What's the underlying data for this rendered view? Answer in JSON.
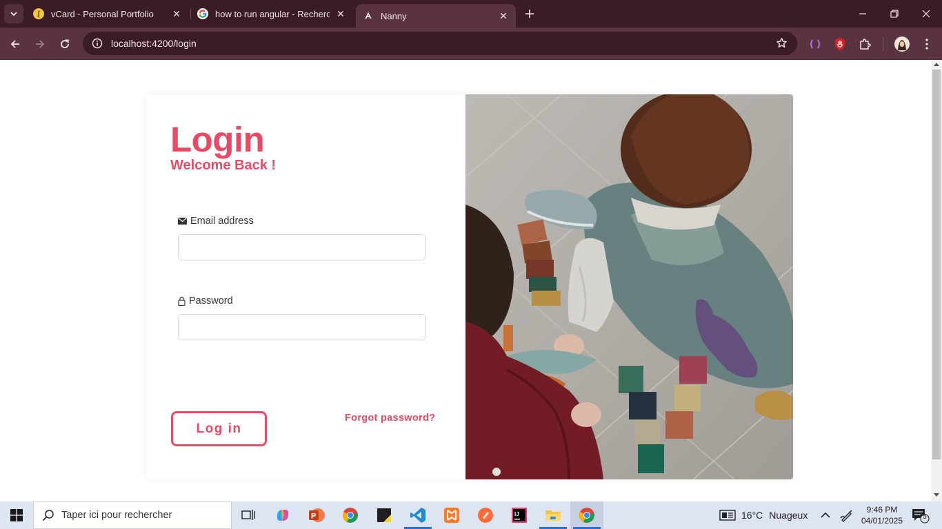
{
  "browser": {
    "tabs": [
      {
        "title": "vCard - Personal Portfolio",
        "favicon": "vcard-favicon"
      },
      {
        "title": "how to run angular - Recherche",
        "favicon": "google-favicon"
      },
      {
        "title": "Nanny",
        "favicon": "angular-favicon",
        "active": true
      }
    ],
    "url": "localhost:4200/login"
  },
  "login": {
    "title": "Login",
    "subtitle": "Welcome Back !",
    "email_label": "Email address",
    "email_value": "",
    "password_label": "Password",
    "password_value": "",
    "submit_label": "Log in",
    "forgot_label": "Forgot password?",
    "accent_color": "#e84a66"
  },
  "taskbar": {
    "search_placeholder": "Taper ici pour rechercher",
    "weather_temp": "16°C",
    "weather_desc": "Nuageux",
    "time": "9:46 PM",
    "date": "04/01/2025",
    "notification_count": "5"
  }
}
